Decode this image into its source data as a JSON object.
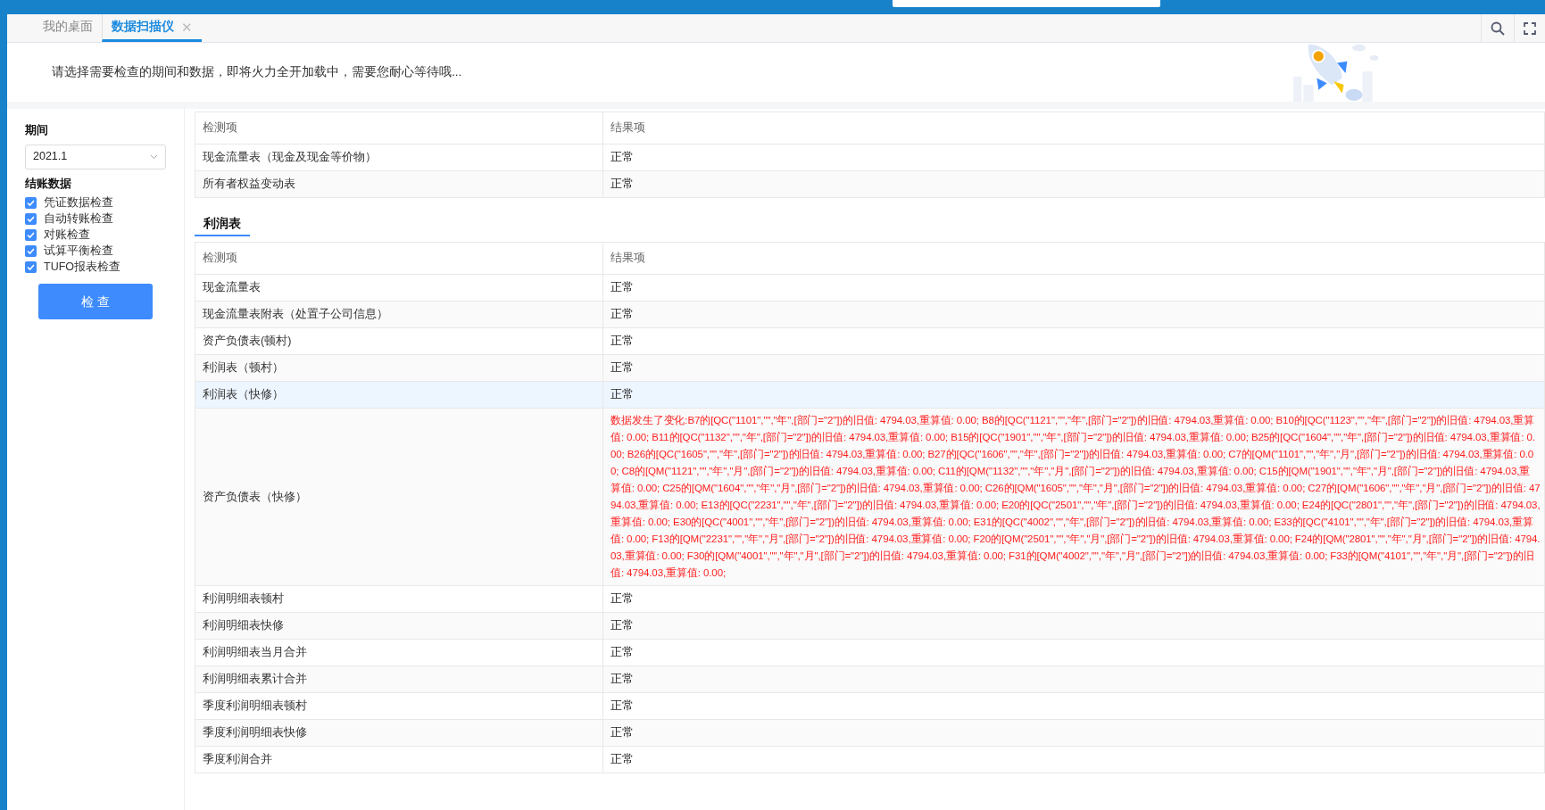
{
  "tabs": [
    {
      "label": "我的桌面",
      "selected": false
    },
    {
      "label": "数据扫描仪",
      "selected": true,
      "close": "✕"
    }
  ],
  "notice": "请选择需要检查的期间和数据，即将火力全开加载中，需要您耐心等待哦...",
  "sidebar": {
    "period_label": "期间",
    "period_value": "2021.1",
    "closing_label": "结账数据",
    "checks": [
      {
        "label": "凭证数据检查",
        "checked": true
      },
      {
        "label": "自动转账检查",
        "checked": true
      },
      {
        "label": "对账检查",
        "checked": true
      },
      {
        "label": "试算平衡检查",
        "checked": true
      },
      {
        "label": "TUFO报表检查",
        "checked": true
      }
    ],
    "button": "检 查"
  },
  "sections": [
    {
      "columns": [
        "检测项",
        "结果项"
      ],
      "rows": [
        {
          "item": "现金流量表（现金及现金等价物）",
          "result": "正常",
          "changed": false,
          "highlighted": false
        },
        {
          "item": "所有者权益变动表",
          "result": "正常",
          "changed": false,
          "highlighted": false
        }
      ]
    },
    {
      "title": "利润表",
      "columns": [
        "检测项",
        "结果项"
      ],
      "rows": [
        {
          "item": "现金流量表",
          "result": "正常",
          "changed": false,
          "highlighted": false
        },
        {
          "item": "现金流量表附表（处置子公司信息）",
          "result": "正常",
          "changed": false,
          "highlighted": false
        },
        {
          "item": "资产负债表(顿村)",
          "result": "正常",
          "changed": false,
          "highlighted": false
        },
        {
          "item": "利润表（顿村）",
          "result": "正常",
          "changed": false,
          "highlighted": false
        },
        {
          "item": "利润表（快修）",
          "result": "正常",
          "changed": false,
          "highlighted": true
        },
        {
          "item": "资产负债表（快修）",
          "result": "数据发生了变化:B7的[QC(\"1101\",\"\",\"年\",[部门=\"2\"])的旧值: 4794.03,重算值: 0.00; B8的[QC(\"1121\",\"\",\"年\",[部门=\"2\"])的旧值: 4794.03,重算值: 0.00; B10的[QC(\"1123\",\"\",\"年\",[部门=\"2\"])的旧值: 4794.03,重算值: 0.00; B11的[QC(\"1132\",\"\",\"年\",[部门=\"2\"])的旧值: 4794.03,重算值: 0.00; B15的[QC(\"1901\",\"\",\"年\",[部门=\"2\"])的旧值: 4794.03,重算值: 0.00; B25的[QC(\"1604\",\"\",\"年\",[部门=\"2\"])的旧值: 4794.03,重算值: 0.00; B26的[QC(\"1605\",\"\",\"年\",[部门=\"2\"])的旧值: 4794.03,重算值: 0.00; B27的[QC(\"1606\",\"\",\"年\",[部门=\"2\"])的旧值: 4794.03,重算值: 0.00; C7的[QM(\"1101\",\"\",\"年\",\"月\",[部门=\"2\"])的旧值: 4794.03,重算值: 0.00; C8的[QM(\"1121\",\"\",\"年\",\"月\",[部门=\"2\"])的旧值: 4794.03,重算值: 0.00; C11的[QM(\"1132\",\"\",\"年\",\"月\",[部门=\"2\"])的旧值: 4794.03,重算值: 0.00; C15的[QM(\"1901\",\"\",\"年\",\"月\",[部门=\"2\"])的旧值: 4794.03,重算值: 0.00; C25的[QM(\"1604\",\"\",\"年\",\"月\",[部门=\"2\"])的旧值: 4794.03,重算值: 0.00; C26的[QM(\"1605\",\"\",\"年\",\"月\",[部门=\"2\"])的旧值: 4794.03,重算值: 0.00; C27的[QM(\"1606\",\"\",\"年\",\"月\",[部门=\"2\"])的旧值: 4794.03,重算值: 0.00; E13的[QC(\"2231\",\"\",\"年\",[部门=\"2\"])的旧值: 4794.03,重算值: 0.00; E20的[QC(\"2501\",\"\",\"年\",[部门=\"2\"])的旧值: 4794.03,重算值: 0.00; E24的[QC(\"2801\",\"\",\"年\",[部门=\"2\"])的旧值: 4794.03,重算值: 0.00; E30的[QC(\"4001\",\"\",\"年\",[部门=\"2\"])的旧值: 4794.03,重算值: 0.00; E31的[QC(\"4002\",\"\",\"年\",[部门=\"2\"])的旧值: 4794.03,重算值: 0.00; E33的[QC(\"4101\",\"\",\"年\",[部门=\"2\"])的旧值: 4794.03,重算值: 0.00; F13的[QM(\"2231\",\"\",\"年\",\"月\",[部门=\"2\"])的旧值: 4794.03,重算值: 0.00; F20的[QM(\"2501\",\"\",\"年\",\"月\",[部门=\"2\"])的旧值: 4794.03,重算值: 0.00; F24的[QM(\"2801\",\"\",\"年\",\"月\",[部门=\"2\"])的旧值: 4794.03,重算值: 0.00; F30的[QM(\"4001\",\"\",\"年\",\"月\",[部门=\"2\"])的旧值: 4794.03,重算值: 0.00; F31的[QM(\"4002\",\"\",\"年\",\"月\",[部门=\"2\"])的旧值: 4794.03,重算值: 0.00; F33的[QM(\"4101\",\"\",\"年\",\"月\",[部门=\"2\"])的旧值: 4794.03,重算值: 0.00;",
          "changed": true,
          "highlighted": false
        },
        {
          "item": "利润明细表顿村",
          "result": "正常",
          "changed": false,
          "highlighted": false
        },
        {
          "item": "利润明细表快修",
          "result": "正常",
          "changed": false,
          "highlighted": false
        },
        {
          "item": "利润明细表当月合并",
          "result": "正常",
          "changed": false,
          "highlighted": false
        },
        {
          "item": "利润明细表累计合并",
          "result": "正常",
          "changed": false,
          "highlighted": false
        },
        {
          "item": "季度利润明细表顿村",
          "result": "正常",
          "changed": false,
          "highlighted": false
        },
        {
          "item": "季度利润明细表快修",
          "result": "正常",
          "changed": false,
          "highlighted": false
        },
        {
          "item": "季度利润合并",
          "result": "正常",
          "changed": false,
          "highlighted": false
        }
      ]
    }
  ]
}
